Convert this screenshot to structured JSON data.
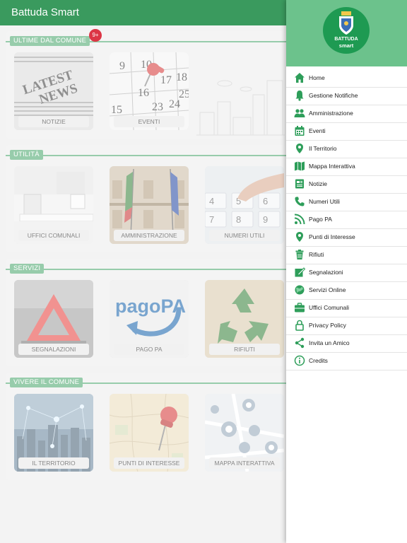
{
  "app": {
    "title": "Battuda Smart"
  },
  "sections": [
    {
      "label": "ULTIME DAL COMUNE",
      "tiles": [
        {
          "caption": "NOTIZIE",
          "badge": "9+"
        },
        {
          "caption": "EVENTI"
        }
      ]
    },
    {
      "label": "UTILITÀ",
      "tiles": [
        {
          "caption": "UFFICI COMUNALI"
        },
        {
          "caption": "AMMINISTRAZIONE"
        },
        {
          "caption": "NUMERI UTILI"
        }
      ]
    },
    {
      "label": "SERVIZI",
      "tiles": [
        {
          "caption": "SEGNALAZIONI"
        },
        {
          "caption": "PAGO PA",
          "logo_text": "pagoPA"
        },
        {
          "caption": "RIFIUTI"
        }
      ]
    },
    {
      "label": "VIVERE IL COMUNE",
      "tiles": [
        {
          "caption": "IL TERRITORIO"
        },
        {
          "caption": "PUNTI DI INTERESSE"
        },
        {
          "caption": "MAPPA INTERATTIVA"
        }
      ]
    }
  ],
  "tile_art": {
    "news_text_1": "LATEST",
    "news_text_2": "NEWS",
    "calendar_numbers": [
      "9",
      "10",
      "17",
      "18",
      "16",
      "23",
      "24",
      "15",
      "25"
    ],
    "keypad_keys": [
      "4",
      "5",
      "6",
      "7",
      "8",
      "9"
    ]
  },
  "drawer": {
    "logo_line1": "BATTUDA",
    "logo_line2": "smart",
    "items": [
      {
        "label": "Home",
        "icon": "home-icon"
      },
      {
        "label": "Gestione Notifiche",
        "icon": "bell-icon"
      },
      {
        "label": "Amministrazione",
        "icon": "people-icon"
      },
      {
        "label": "Eventi",
        "icon": "calendar-icon"
      },
      {
        "label": "Il Territorio",
        "icon": "map-pin-icon"
      },
      {
        "label": "Mappa Interattiva",
        "icon": "map-icon"
      },
      {
        "label": "Notizie",
        "icon": "news-icon"
      },
      {
        "label": "Numeri Utili",
        "icon": "phone-icon"
      },
      {
        "label": "Pago PA",
        "icon": "rss-icon"
      },
      {
        "label": "Punti di Interesse",
        "icon": "map-pin-icon"
      },
      {
        "label": "Rifiuti",
        "icon": "trash-icon"
      },
      {
        "label": "Segnalazioni",
        "icon": "edit-icon"
      },
      {
        "label": "Servizi Online",
        "icon": "globe-icon"
      },
      {
        "label": "Uffici Comunali",
        "icon": "briefcase-icon"
      },
      {
        "label": "Privacy Policy",
        "icon": "lock-icon"
      },
      {
        "label": "Invita un Amico",
        "icon": "share-icon"
      },
      {
        "label": "Credits",
        "icon": "info-icon"
      }
    ]
  },
  "colors": {
    "primary": "#3a9a5e",
    "drawer_header": "#6cc28c",
    "accent_icon": "#2e9e5a",
    "badge": "#dc3545"
  }
}
